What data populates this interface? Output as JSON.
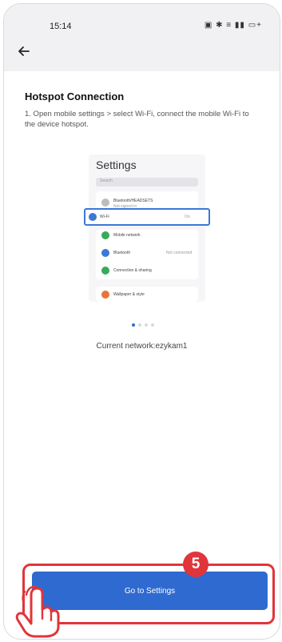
{
  "status_bar": {
    "time": "15:14",
    "icons": "▣ ✱ ≡ ▮▮ ▭+"
  },
  "header": {
    "back_icon": "arrow-left-icon"
  },
  "page": {
    "title": "Hotspot Connection",
    "instruction": "1. Open mobile settings > select Wi-Fi, connect the mobile Wi-Fi to the device hotspot."
  },
  "illustration": {
    "title": "Settings",
    "search_placeholder": "Search",
    "rows": [
      {
        "label": "Bluetooth/HEADSETS",
        "sub": "Not signed in",
        "color": "#bdbdbd",
        "icon": "account-icon"
      },
      {
        "label": "Wi-Fi",
        "value": "On",
        "color": "#3b78d8",
        "icon": "wifi-icon"
      },
      {
        "label": "Mobile network",
        "color": "#3aaa5a",
        "icon": "mobile-network-icon"
      },
      {
        "label": "Bluetooth",
        "value": "Not connected",
        "color": "#3b78d8",
        "icon": "bluetooth-icon"
      },
      {
        "label": "Connection & sharing",
        "color": "#3aaa5a",
        "icon": "sharing-icon"
      },
      {
        "label": "Wallpaper & style",
        "color": "#e7743b",
        "icon": "wallpaper-icon"
      }
    ]
  },
  "pager": {
    "count": 4,
    "active_index": 0
  },
  "network": {
    "text": "Current network:ezykam1"
  },
  "footer": {
    "button_label": "Go to Settings",
    "step_number": "5"
  },
  "colors": {
    "primary": "#2e6ad0",
    "highlight": "#e0353b"
  }
}
